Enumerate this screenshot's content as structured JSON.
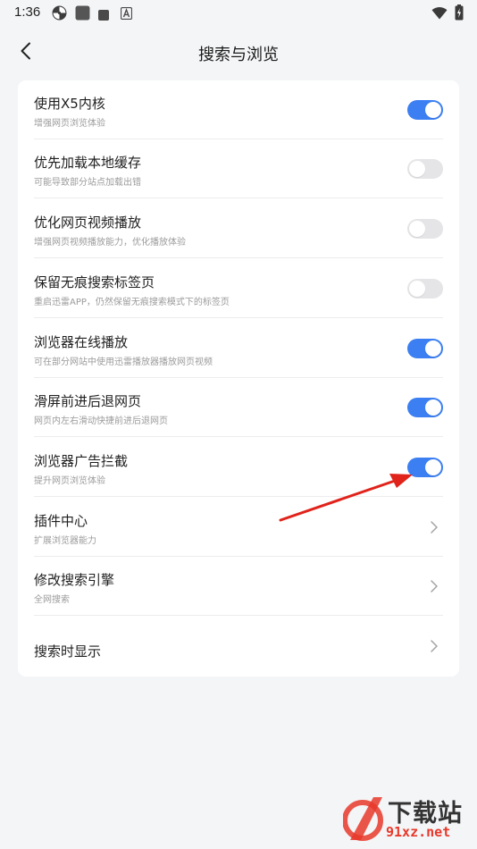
{
  "status_bar": {
    "time": "1:36",
    "icons": [
      "pinwheel-icon",
      "square-icon",
      "small-square-icon",
      "a-box-icon"
    ],
    "right_icons": [
      "wifi-icon",
      "battery-charging-icon"
    ]
  },
  "header": {
    "title": "搜索与浏览",
    "back_icon": "chevron-left-icon"
  },
  "settings": [
    {
      "title": "使用X5内核",
      "subtitle": "增强网页浏览体验",
      "control": "toggle",
      "on": true
    },
    {
      "title": "优先加载本地缓存",
      "subtitle": "可能导致部分站点加载出错",
      "control": "toggle",
      "on": false
    },
    {
      "title": "优化网页视频播放",
      "subtitle": "增强网页视频播放能力，优化播放体验",
      "control": "toggle",
      "on": false
    },
    {
      "title": "保留无痕搜索标签页",
      "subtitle": "重启迅雷APP，仍然保留无痕搜索模式下的标签页",
      "control": "toggle",
      "on": false
    },
    {
      "title": "浏览器在线播放",
      "subtitle": "可在部分网站中使用迅雷播放器播放网页视频",
      "control": "toggle",
      "on": true
    },
    {
      "title": "滑屏前进后退网页",
      "subtitle": "网页内左右滑动快捷前进后退网页",
      "control": "toggle",
      "on": true
    },
    {
      "title": "浏览器广告拦截",
      "subtitle": "提升网页浏览体验",
      "control": "toggle",
      "on": true
    },
    {
      "title": "插件中心",
      "subtitle": "扩展浏览器能力",
      "control": "chevron"
    },
    {
      "title": "修改搜索引擎",
      "subtitle": "全网搜索",
      "control": "chevron"
    },
    {
      "title": "搜索时显示",
      "subtitle": "",
      "control": "chevron"
    }
  ],
  "colors": {
    "toggle_on": "#3b7ff2",
    "toggle_off": "#e5e5e7",
    "background": "#f4f5f7",
    "annotation_arrow": "#e0231b"
  },
  "watermark": {
    "text": "下载站",
    "url": "91xz.net"
  }
}
